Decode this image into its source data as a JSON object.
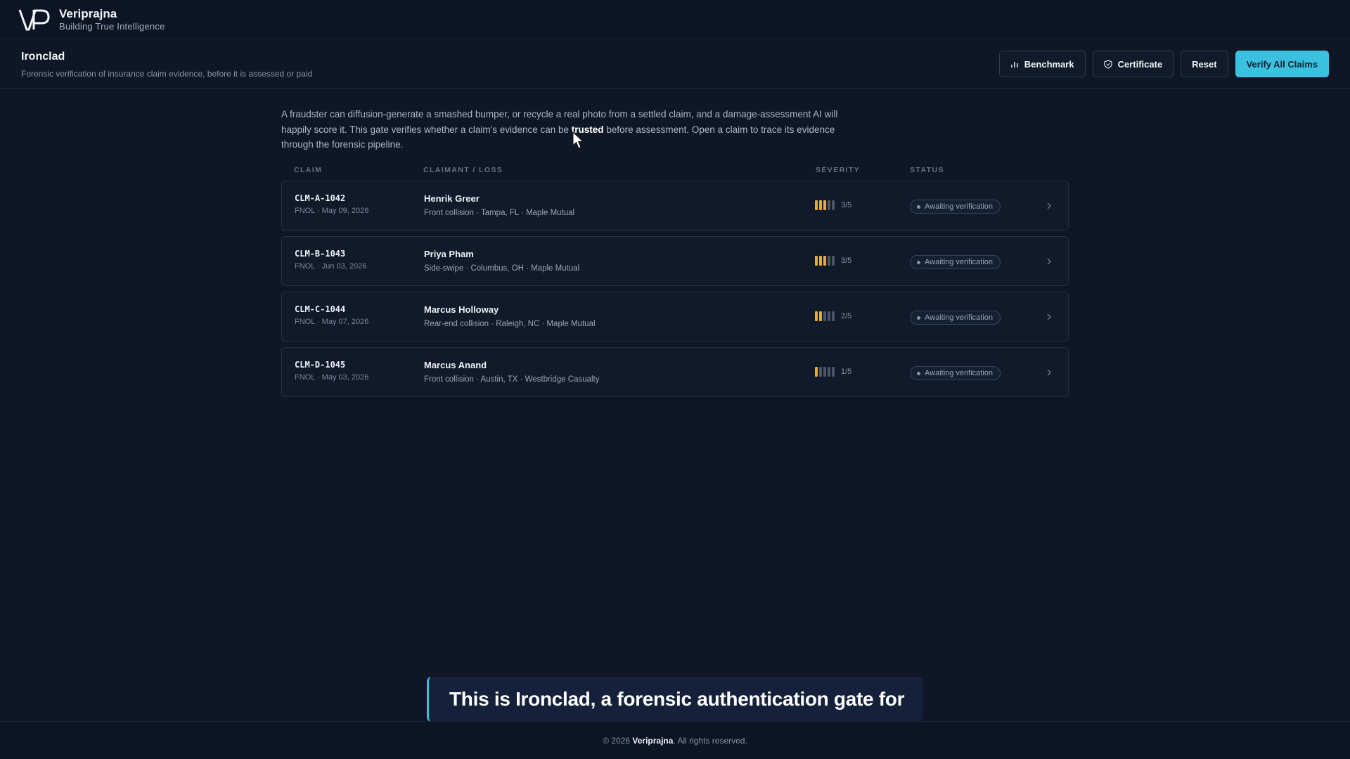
{
  "brand": {
    "name": "Veriprajna",
    "tagline": "Building True Intelligence"
  },
  "header": {
    "title": "Ironclad",
    "subtitle": "Forensic verification of insurance claim evidence, before it is assessed or paid",
    "buttons": {
      "benchmark": "Benchmark",
      "certificate": "Certificate",
      "reset": "Reset",
      "verify_all": "Verify All Claims"
    }
  },
  "intro": {
    "part1": "A fraudster can diffusion-generate a smashed bumper, or recycle a real photo from a settled claim, and a damage-assessment AI will happily score it. This gate verifies whether a claim's evidence can be ",
    "emphasis": "trusted",
    "part2": " before assessment. Open a claim to trace its evidence through the forensic pipeline."
  },
  "table": {
    "columns": {
      "claim": "CLAIM",
      "claimant": "CLAIMANT / LOSS",
      "severity": "SEVERITY",
      "status": "STATUS"
    },
    "rows": [
      {
        "id": "CLM-A-1042",
        "date": "FNOL · May 09, 2026",
        "name": "Henrik Greer",
        "loss": "Front collision · Tampa, FL · Maple Mutual",
        "severity": 3,
        "severity_label": "3/5",
        "status": "Awaiting verification"
      },
      {
        "id": "CLM-B-1043",
        "date": "FNOL · Jun 03, 2026",
        "name": "Priya Pham",
        "loss": "Side-swipe · Columbus, OH · Maple Mutual",
        "severity": 3,
        "severity_label": "3/5",
        "status": "Awaiting verification"
      },
      {
        "id": "CLM-C-1044",
        "date": "FNOL · May 07, 2026",
        "name": "Marcus Holloway",
        "loss": "Rear-end collision · Raleigh, NC · Maple Mutual",
        "severity": 2,
        "severity_label": "2/5",
        "status": "Awaiting verification"
      },
      {
        "id": "CLM-D-1045",
        "date": "FNOL · May 03, 2026",
        "name": "Marcus Anand",
        "loss": "Front collision · Austin, TX · Westbridge Casualty",
        "severity": 1,
        "severity_label": "1/5",
        "status": "Awaiting verification"
      }
    ]
  },
  "caption": "This is Ironclad, a forensic authentication gate for",
  "footer": {
    "prefix": "© 2026 ",
    "brand": "Veriprajna",
    "suffix": ". All rights reserved."
  },
  "colors": {
    "accent": "#3cc0e0",
    "severity_on": "#e9a93c",
    "severity_off": "#4b5568",
    "background": "#0f1726"
  },
  "icons": {
    "benchmark": "bar-chart-icon",
    "certificate": "shield-icon",
    "row_action": "chevron-right-icon"
  }
}
